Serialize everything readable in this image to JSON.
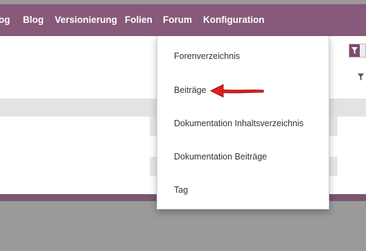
{
  "nav": {
    "items": [
      {
        "label": "og"
      },
      {
        "label": "Blog"
      },
      {
        "label": "Versionierung"
      },
      {
        "label": "Folien"
      },
      {
        "label": "Forum"
      },
      {
        "label": "Konfiguration"
      }
    ]
  },
  "dropdown": {
    "items": [
      {
        "label": "Forenverzeichnis"
      },
      {
        "label": "Beiträge"
      },
      {
        "label": "Dokumentation Inhaltsverzeichnis"
      },
      {
        "label": "Dokumentation Beiträge"
      },
      {
        "label": "Tag"
      }
    ]
  },
  "icons": {
    "filter_button": "filter-icon",
    "filter_small": "filter-icon",
    "annotation": "red-arrow-icon"
  },
  "colors": {
    "navbar": "#875a7b",
    "arrow": "#e01e1e"
  }
}
